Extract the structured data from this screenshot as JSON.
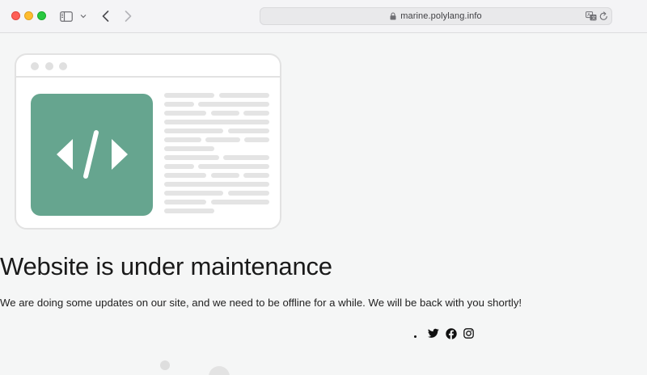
{
  "browser": {
    "url": "marine.polylang.info",
    "icons": {
      "sidebar": "sidebar-icon",
      "chevron": "chevron-down-icon",
      "back": "back-arrow-icon",
      "forward": "forward-arrow-icon",
      "lock": "lock-icon",
      "translate": "translate-icon",
      "reload": "reload-icon"
    },
    "traffic_colors": {
      "close": "#fe5f57",
      "minimize": "#febc2e",
      "zoom": "#28c840"
    }
  },
  "illustration": {
    "icon": "code-icon",
    "accent_color": "#66a58f"
  },
  "main": {
    "title": "Website is under maintenance",
    "message": "We are doing some updates on our site, and we need to be offline for a while. We will be back with you shortly!"
  },
  "social": {
    "icons": [
      "twitter-icon",
      "facebook-icon",
      "instagram-icon"
    ]
  }
}
